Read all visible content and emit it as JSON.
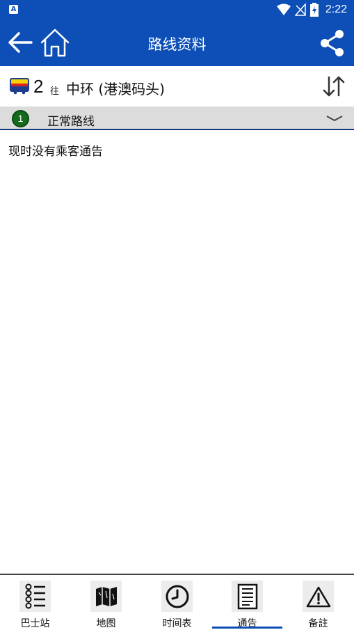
{
  "statusbar": {
    "time": "2:22",
    "notification_badge": "A"
  },
  "appbar": {
    "title": "路线资料",
    "back_icon": "arrow-left-icon",
    "home_icon": "home-icon",
    "share_icon": "share-icon"
  },
  "route": {
    "number": "2",
    "to_label": "往",
    "destination": "中环 (港澳码头)",
    "bus_icon": "bus-icon",
    "swap_icon": "swap-direction-icon"
  },
  "variant": {
    "badge": "1",
    "label": "正常路线",
    "expand_icon": "chevron-down-icon"
  },
  "notice": {
    "text": "现时没有乘客通告"
  },
  "bottom_nav": {
    "items": [
      {
        "label": "巴士站",
        "icon": "stops-list-icon"
      },
      {
        "label": "地图",
        "icon": "map-icon"
      },
      {
        "label": "时间表",
        "icon": "clock-icon"
      },
      {
        "label": "通告",
        "icon": "notice-icon",
        "active": true
      },
      {
        "label": "备註",
        "icon": "warning-icon"
      }
    ]
  },
  "colors": {
    "primary": "#0d4fb6",
    "variant_bg": "#dcdcdc",
    "badge_green": "#146b1e"
  }
}
